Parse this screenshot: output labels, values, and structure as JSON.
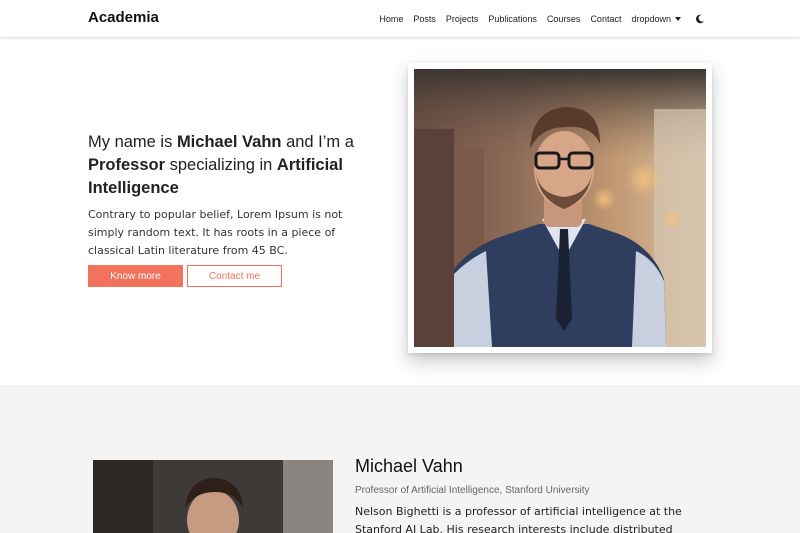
{
  "navbar": {
    "brand": "Academia",
    "links": [
      {
        "label": "Home"
      },
      {
        "label": "Posts"
      },
      {
        "label": "Projects"
      },
      {
        "label": "Publications"
      },
      {
        "label": "Courses"
      },
      {
        "label": "Contact"
      },
      {
        "label": "dropdown"
      }
    ],
    "theme_toggle_icon": "moon-icon"
  },
  "hero": {
    "heading_pre": "My name is ",
    "heading_name": "Michael Vahn",
    "heading_mid1": " and I’m a ",
    "heading_role": "Professor",
    "heading_mid2": " specializing in ",
    "heading_field": "Artificial Intelligence",
    "description": "Contrary to popular belief, Lorem Ipsum is not simply random text. It has roots in a piece of classical Latin literature from 45 BC.",
    "primary_button": "Know more",
    "secondary_button": "Contact me",
    "accent_color": "#f2725c"
  },
  "about": {
    "name": "Michael Vahn",
    "title": "Professor of Artificial Intelligence, Stanford University",
    "bio": "Nelson Bighetti is a professor of artificial intelligence at the Stanford AI Lab. His research interests include distributed robotics, mobile"
  }
}
